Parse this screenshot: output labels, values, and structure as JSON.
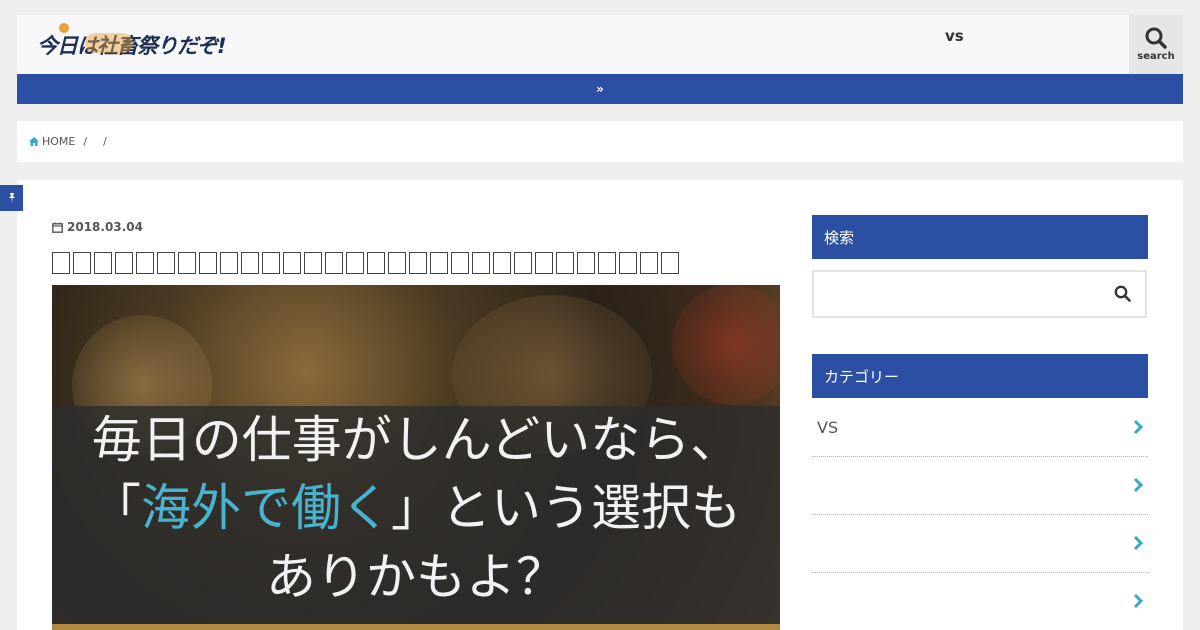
{
  "header": {
    "logo_text": "今日は社畜祭りだぞ!",
    "nav_item": "vs",
    "search_label": "search"
  },
  "notice": {
    "arrow": "»"
  },
  "breadcrumb": {
    "home_label": "HOME",
    "sep1": "/",
    "sep2": "/"
  },
  "article": {
    "date": "2018.03.04",
    "hero": {
      "line1": "毎日の仕事がしんどいなら、",
      "line2_open": "「",
      "line2_accent": "海外で働く",
      "line2_rest": "」という選択も",
      "line3": "ありかもよ？"
    }
  },
  "sidebar": {
    "widget1_title": "検索",
    "search_placeholder": "",
    "widget2_title": "カテゴリー",
    "items": [
      {
        "label": "VS"
      },
      {
        "label": ""
      },
      {
        "label": ""
      },
      {
        "label": ""
      }
    ]
  },
  "colors": {
    "brand_blue": "#2a4fa3",
    "accent_teal": "#35a9c6",
    "logo_navy": "#1d2f55"
  }
}
